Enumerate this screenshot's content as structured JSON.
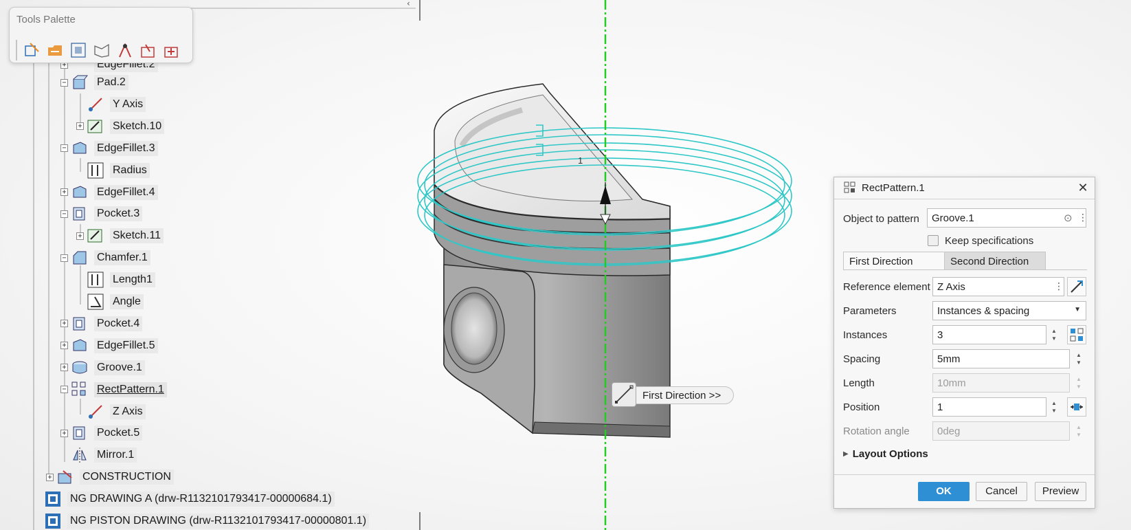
{
  "tools_palette": {
    "title": "Tools Palette",
    "tools": [
      {
        "icon": "3d-grid-select-icon",
        "color": "#2d6fb6"
      },
      {
        "icon": "open-folder-icon",
        "color": "#e88a1e"
      },
      {
        "icon": "snap-to-box-icon",
        "color": "#3a6aa8"
      },
      {
        "icon": "plane-icon",
        "color": "#666666"
      },
      {
        "icon": "compass-icon",
        "color": "#c23b3b"
      },
      {
        "icon": "measure-item-icon",
        "color": "#c23b3b"
      },
      {
        "icon": "measure-between-icon",
        "color": "#c23b3b"
      }
    ]
  },
  "spec_tree": {
    "partial_label": "EdgeFillet.2",
    "nodes": [
      {
        "label": "Pad.2",
        "icon": "pad-icon",
        "expander": "−"
      },
      {
        "label": "Y Axis",
        "icon": "axis-icon",
        "expander": ""
      },
      {
        "label": "Sketch.10",
        "icon": "sketch-icon",
        "expander": "+"
      },
      {
        "label": "EdgeFillet.3",
        "icon": "edge-fillet-icon",
        "expander": "−"
      },
      {
        "label": "Radius",
        "icon": "radius-parameter-icon",
        "expander": ""
      },
      {
        "label": "EdgeFillet.4",
        "icon": "edge-fillet-icon",
        "expander": "+"
      },
      {
        "label": "Pocket.3",
        "icon": "pocket-icon",
        "expander": "−"
      },
      {
        "label": "Sketch.11",
        "icon": "sketch-icon",
        "expander": "+"
      },
      {
        "label": "Chamfer.1",
        "icon": "chamfer-icon",
        "expander": "−"
      },
      {
        "label": "Length1",
        "icon": "length-parameter-icon",
        "expander": ""
      },
      {
        "label": "Angle",
        "icon": "angle-parameter-icon",
        "expander": ""
      },
      {
        "label": "Pocket.4",
        "icon": "pocket-icon",
        "expander": "+"
      },
      {
        "label": "EdgeFillet.5",
        "icon": "edge-fillet-icon",
        "expander": "+"
      },
      {
        "label": "Groove.1",
        "icon": "groove-icon",
        "expander": "+"
      },
      {
        "label": "RectPattern.1",
        "icon": "rect-pattern-icon",
        "expander": "−",
        "selected": true
      },
      {
        "label": "Z Axis",
        "icon": "axis-icon",
        "expander": ""
      },
      {
        "label": "Pocket.5",
        "icon": "pocket-icon",
        "expander": "+"
      },
      {
        "label": "Mirror.1",
        "icon": "mirror-icon",
        "expander": ""
      },
      {
        "label": "CONSTRUCTION",
        "icon": "construction-icon",
        "expander": "+"
      },
      {
        "label": "NG DRAWING A (drw-R1132101793417-00000684.1)",
        "icon": "drawing-icon",
        "expander": ""
      },
      {
        "label": "NG PISTON DRAWING (drw-R1132101793417-00000801.1)",
        "icon": "drawing-icon",
        "expander": ""
      }
    ]
  },
  "viewport": {
    "axis_color": "#22cc22",
    "pattern_preview_color": "#2fc7c7",
    "instance_label": "1",
    "direction_tag": "First Direction >>"
  },
  "dialog": {
    "title": "RectPattern.1",
    "object_to_pattern_label": "Object to pattern",
    "object_to_pattern_value": "Groove.1",
    "keep_specifications_label": "Keep specifications",
    "keep_specifications_checked": false,
    "tabs": [
      "First Direction",
      "Second Direction"
    ],
    "active_tab": "First Direction",
    "reference_element_label": "Reference element",
    "reference_element_value": "Z Axis",
    "parameters_label": "Parameters",
    "parameters_value": "Instances & spacing",
    "instances_label": "Instances",
    "instances_value": "3",
    "spacing_label": "Spacing",
    "spacing_value": "5mm",
    "length_label": "Length",
    "length_value": "10mm",
    "position_label": "Position",
    "position_value": "1",
    "rotation_angle_label": "Rotation angle",
    "rotation_angle_value": "0deg",
    "layout_options_label": "Layout Options",
    "ok_label": "OK",
    "cancel_label": "Cancel",
    "preview_label": "Preview",
    "accent_color": "#2f8fd4"
  }
}
